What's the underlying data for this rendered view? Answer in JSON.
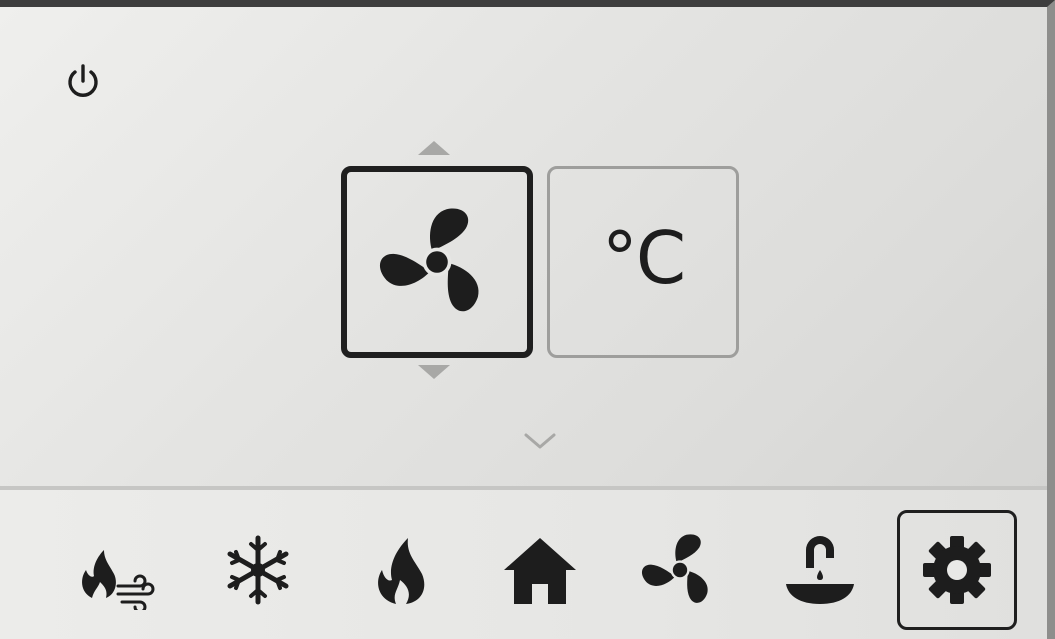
{
  "display": {
    "temperature_unit": "°C",
    "selected_option": "fan"
  },
  "nav": {
    "items": [
      {
        "id": "heat-air",
        "icon": "flame-wind-icon"
      },
      {
        "id": "cool",
        "icon": "snowflake-icon"
      },
      {
        "id": "heat",
        "icon": "flame-icon"
      },
      {
        "id": "home",
        "icon": "home-icon"
      },
      {
        "id": "fan",
        "icon": "fan-icon"
      },
      {
        "id": "hot-water",
        "icon": "tap-basin-icon"
      },
      {
        "id": "settings",
        "icon": "gear-icon",
        "selected": true
      }
    ]
  },
  "colors": {
    "icon": "#1d1d1d",
    "inactive": "#a8a8a6",
    "selected_border": "#1f1f1f"
  }
}
